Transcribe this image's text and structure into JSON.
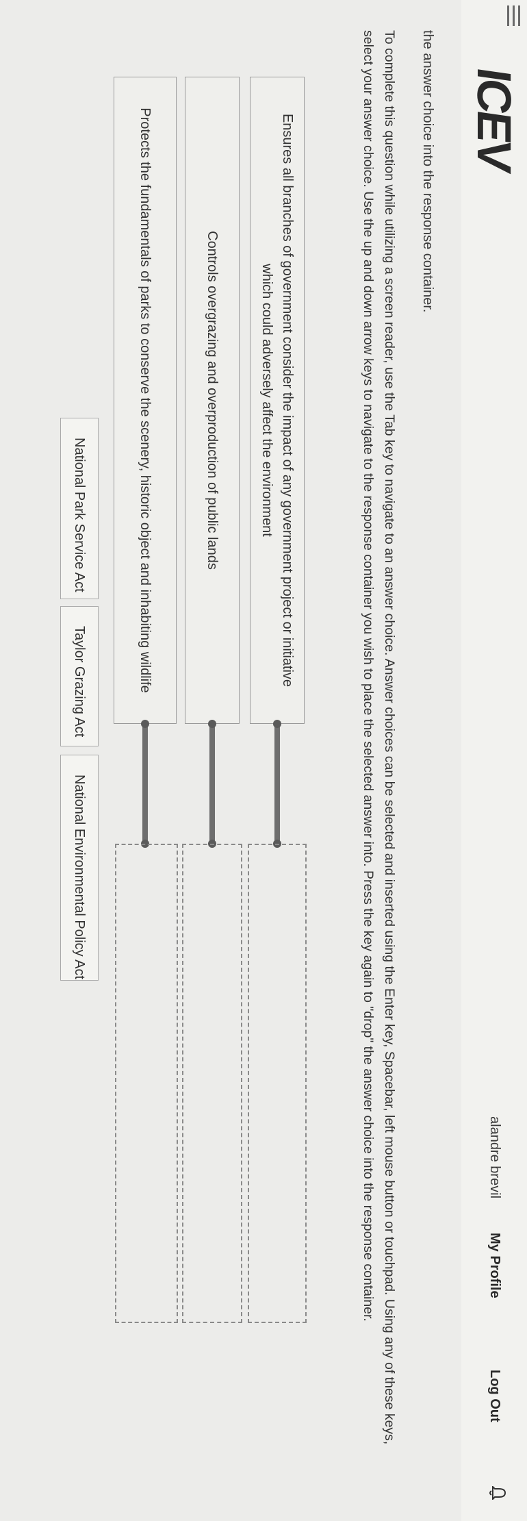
{
  "header": {
    "logo_text": "ICEV",
    "user_name": "alandre brevil",
    "profile_link": "My Profile",
    "logout_link": "Log Out",
    "menu_icon": "hamburger-icon",
    "notification_icon": "bell-icon"
  },
  "question": {
    "subtitle": "the answer choice into the response container.",
    "instructions": "To complete this question while utilizing a screen reader, use the Tab key to navigate to an answer choice. Answer choices can be selected and inserted using the Enter key, Spacebar, left mouse button or touchpad. Using any of these keys, select your answer choice. Use the up and down arrow keys to navigate to the response container you wish to place the selected answer into. Press the key again to \"drop\" the answer choice into the response container."
  },
  "prompts": [
    {
      "text": "Ensures all branches of government consider the impact of any government project or initiative which could adversely affect the environment"
    },
    {
      "text": "Controls overgrazing and overproduction of public lands"
    },
    {
      "text": "Protects the fundamentals of parks to conserve the scenery, historic object and inhabiting wildlife"
    }
  ],
  "answer_choices": [
    {
      "label": "National Park Service Act"
    },
    {
      "label": "Taylor Grazing Act"
    },
    {
      "label": "National Environmental Policy Act"
    }
  ],
  "colors": {
    "connector": "#6e6e6e",
    "dashed_border": "#8a8a8a"
  }
}
